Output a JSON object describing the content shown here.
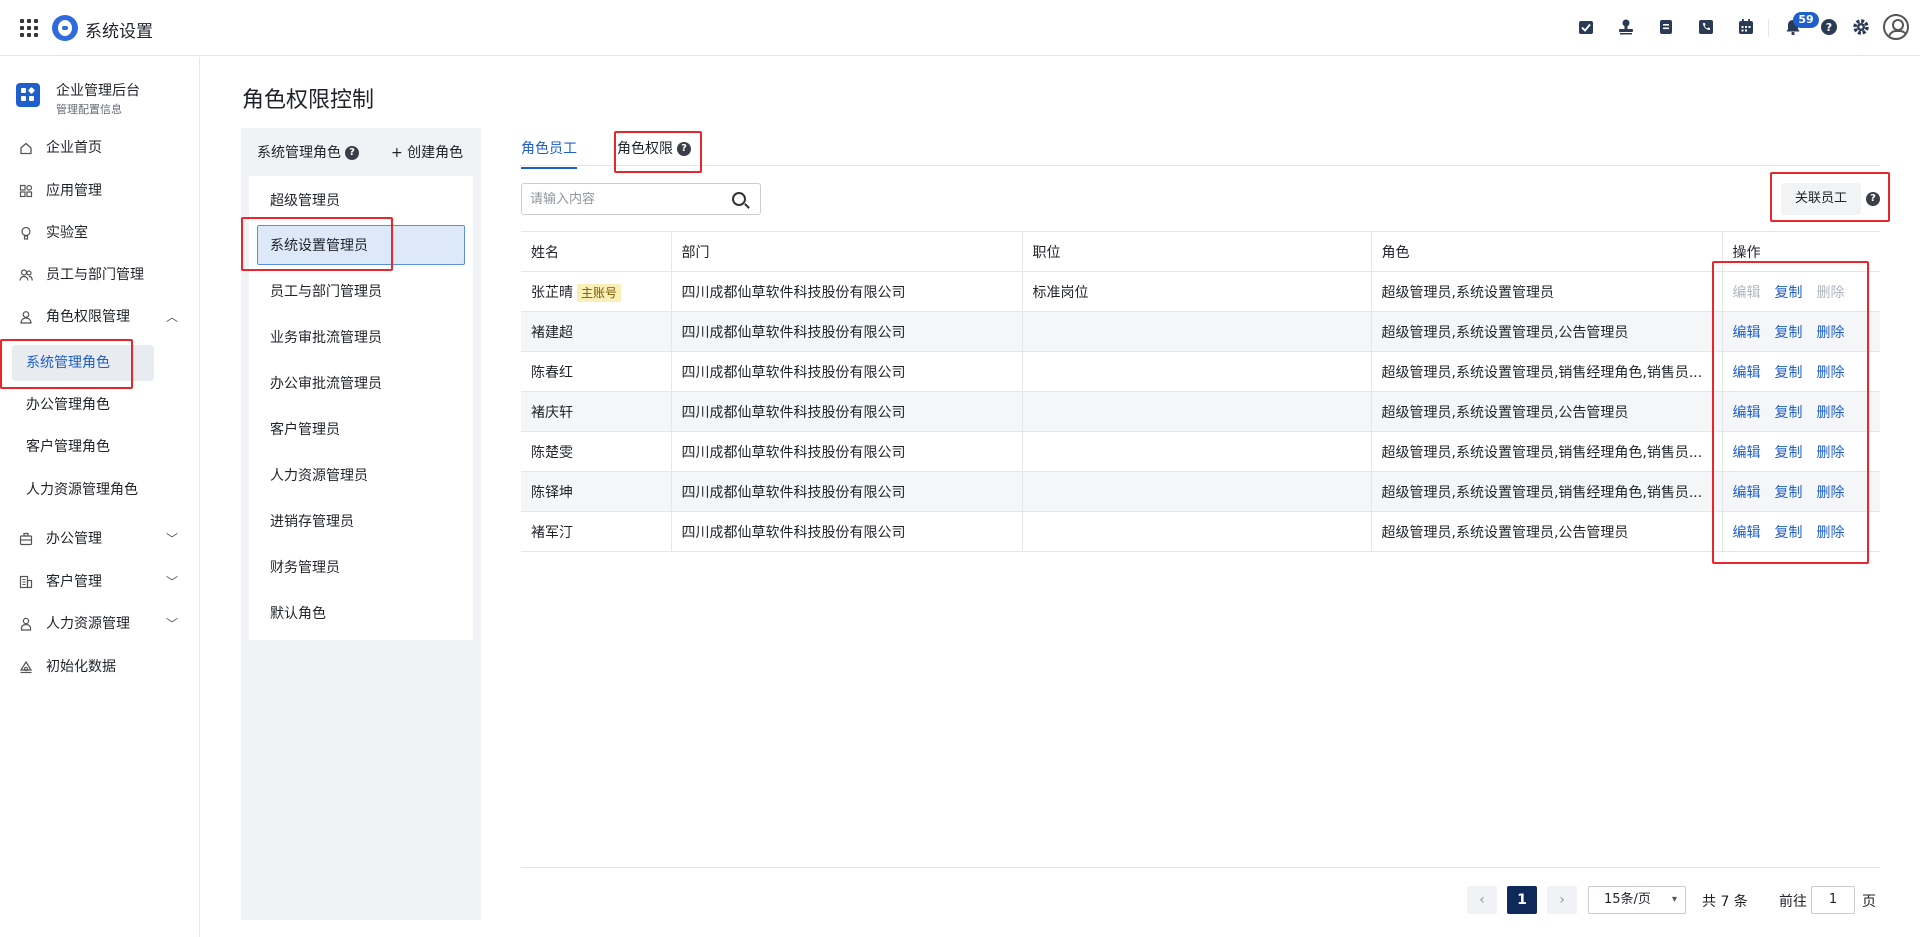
{
  "header": {
    "app_title": "系统设置",
    "notification_count": "59"
  },
  "sidebar": {
    "org_name": "企业管理后台",
    "org_sub": "管理配置信息",
    "items": [
      {
        "label": "企业首页",
        "icon": "home-icon"
      },
      {
        "label": "应用管理",
        "icon": "apps-icon"
      },
      {
        "label": "实验室",
        "icon": "bulb-icon"
      },
      {
        "label": "员工与部门管理",
        "icon": "users-icon"
      },
      {
        "label": "角色权限管理",
        "icon": "user-role-icon"
      },
      {
        "label": "办公管理",
        "icon": "briefcase-icon"
      },
      {
        "label": "客户管理",
        "icon": "building-icon"
      },
      {
        "label": "人力资源管理",
        "icon": "person-icon"
      },
      {
        "label": "初始化数据",
        "icon": "init-icon"
      }
    ],
    "sub_items": [
      "系统管理角色",
      "办公管理角色",
      "客户管理角色",
      "人力资源管理角色"
    ]
  },
  "page": {
    "title": "角色权限控制"
  },
  "role_panel": {
    "header": "系统管理角色",
    "create": "+ 创建角色",
    "roles": [
      "超级管理员",
      "系统设置管理员",
      "员工与部门管理员",
      "业务审批流管理员",
      "办公审批流管理员",
      "客户管理员",
      "人力资源管理员",
      "进销存管理员",
      "财务管理员",
      "默认角色"
    ]
  },
  "tabs": [
    "角色员工",
    "角色权限"
  ],
  "search": {
    "placeholder": "请输入内容"
  },
  "link_button": "关联员工",
  "table": {
    "headers": [
      "姓名",
      "部门",
      "职位",
      "角色",
      "操作"
    ],
    "rows": [
      {
        "name": "张芷晴",
        "tag": "主账号",
        "dept": "四川成都仙草软件科技股份有限公司",
        "position": "标准岗位",
        "role": "超级管理员,系统设置管理员"
      },
      {
        "name": "褚建超",
        "tag": "",
        "dept": "四川成都仙草软件科技股份有限公司",
        "position": "",
        "role": "超级管理员,系统设置管理员,公告管理员"
      },
      {
        "name": "陈春红",
        "tag": "",
        "dept": "四川成都仙草软件科技股份有限公司",
        "position": "",
        "role": "超级管理员,系统设置管理员,销售经理角色,销售员..."
      },
      {
        "name": "褚庆轩",
        "tag": "",
        "dept": "四川成都仙草软件科技股份有限公司",
        "position": "",
        "role": "超级管理员,系统设置管理员,公告管理员"
      },
      {
        "name": "陈楚雯",
        "tag": "",
        "dept": "四川成都仙草软件科技股份有限公司",
        "position": "",
        "role": "超级管理员,系统设置管理员,销售经理角色,销售员..."
      },
      {
        "name": "陈铎坤",
        "tag": "",
        "dept": "四川成都仙草软件科技股份有限公司",
        "position": "",
        "role": "超级管理员,系统设置管理员,销售经理角色,销售员..."
      },
      {
        "name": "褚军汀",
        "tag": "",
        "dept": "四川成都仙草软件科技股份有限公司",
        "position": "",
        "role": "超级管理员,系统设置管理员,公告管理员"
      }
    ],
    "actions": {
      "edit": "编辑",
      "copy": "复制",
      "delete": "删除"
    }
  },
  "pagination": {
    "current": "1",
    "page_size": "15条/页",
    "total": "共 7 条",
    "goto_label": "前往",
    "goto_value": "1",
    "page_unit": "页"
  },
  "colors": {
    "accent": "#1f5fcc",
    "annotation": "#e8262b"
  }
}
